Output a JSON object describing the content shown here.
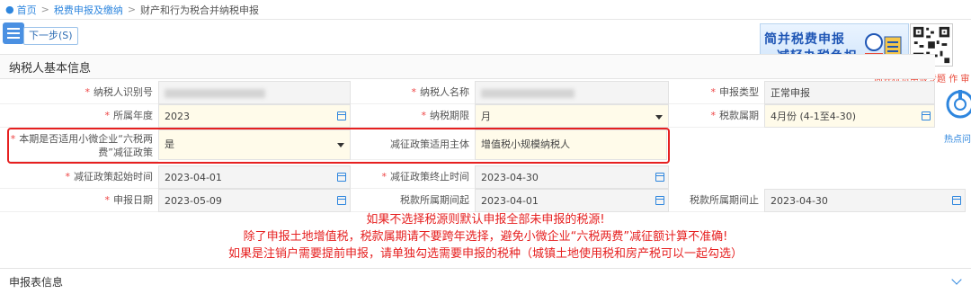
{
  "breadcrumb": {
    "home": "首页",
    "level1": "税费申报及缴纳",
    "current": "财产和行为税合并纳税申报"
  },
  "toolbar": {
    "next_label": "下一步(S)"
  },
  "promo": {
    "line1": "简并税费申报",
    "line2": "减轻办税负担",
    "caption": "简并税费申报专题",
    "side_caption_suffix": "作 审",
    "hot_label": "热点问"
  },
  "section": {
    "title": "纳税人基本信息"
  },
  "fields": {
    "taxpayer_id": {
      "label": "纳税人识别号"
    },
    "taxpayer_name": {
      "label": "纳税人名称"
    },
    "filing_type": {
      "label": "申报类型",
      "value": "正常申报"
    },
    "year": {
      "label": "所属年度",
      "value": "2023"
    },
    "period": {
      "label": "纳税期限",
      "value": "月"
    },
    "tax_period": {
      "label": "税款属期",
      "value": "4月份 (4-1至4-30)"
    },
    "small_micro": {
      "label": "本期是否适用小微企业“六税两费”减征政策",
      "value": "是"
    },
    "reduction_subject": {
      "label": "减征政策适用主体",
      "value": "增值税小规模纳税人"
    },
    "policy_start": {
      "label": "减征政策起始时间",
      "value": "2023-04-01"
    },
    "policy_end": {
      "label": "减征政策终止时间",
      "value": "2023-04-30"
    },
    "filing_date": {
      "label": "申报日期",
      "value": "2023-05-09"
    },
    "period_start": {
      "label": "税款所属期间起",
      "value": "2023-04-01"
    },
    "period_end": {
      "label": "税款所属期间止",
      "value": "2023-04-30"
    }
  },
  "notice": {
    "line1": "如果不选择税源则默认申报全部未申报的税源!",
    "line2": "除了申报土地增值税，税款属期请不要跨年选择，避免小微企业“六税两费”减征额计算不准确!",
    "line3": "如果是注销户需要提前申报，请单独勾选需要申报的税种（城镇土地使用税和房产税可以一起勾选）"
  },
  "section2": {
    "title": "申报表信息"
  },
  "colors": {
    "accent": "#2e86de",
    "alert": "#e62020",
    "editable_bg": "#fffbea",
    "readonly_bg": "#f4f4f4"
  }
}
